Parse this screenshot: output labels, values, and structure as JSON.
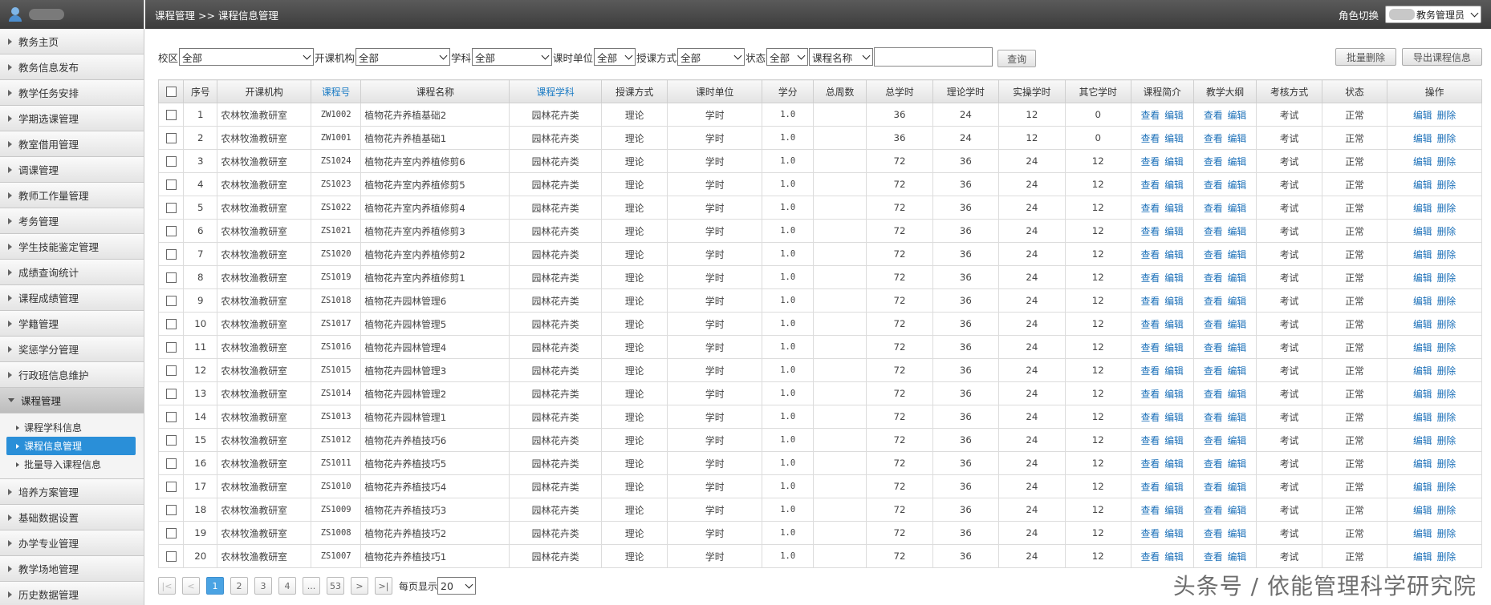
{
  "sidebar": {
    "items_top": [
      "教务主页",
      "教务信息发布",
      "教学任务安排",
      "学期选课管理",
      "教室借用管理",
      "调课管理",
      "教师工作量管理",
      "考务管理",
      "学生技能鉴定管理",
      "成绩查询统计",
      "课程成绩管理",
      "学籍管理",
      "奖惩学分管理",
      "行政班信息维护"
    ],
    "open_item": "课程管理",
    "sub_items": [
      "课程学科信息",
      "课程信息管理",
      "批量导入课程信息"
    ],
    "active_sub": 1,
    "items_bottom": [
      "培养方案管理",
      "基础数据设置",
      "办学专业管理",
      "教学场地管理",
      "历史数据管理"
    ]
  },
  "header": {
    "breadcrumb": "课程管理 >> 课程信息管理",
    "role_label": "角色切换",
    "role_value": "教务管理员"
  },
  "filters": {
    "campus_label": "校区",
    "campus_value": "全部",
    "org_label": "开课机构",
    "org_value": "全部",
    "subject_label": "学科",
    "subject_value": "全部",
    "unit_label": "课时单位",
    "unit_value": "全部",
    "mode_label": "授课方式",
    "mode_value": "全部",
    "status_label": "状态",
    "status_value": "全部",
    "field_select": "课程名称",
    "search_value": "",
    "query_button": "查询",
    "batch_delete_button": "批量删除",
    "export_button": "导出课程信息"
  },
  "table": {
    "headers": [
      "序号",
      "开课机构",
      "课程号",
      "课程名称",
      "课程学科",
      "授课方式",
      "课时单位",
      "学分",
      "总周数",
      "总学时",
      "理论学时",
      "实操学时",
      "其它学时",
      "课程简介",
      "教学大纲",
      "考核方式",
      "状态",
      "操作"
    ],
    "sortable": [
      2,
      4
    ],
    "link_view": "查看",
    "link_edit": "编辑",
    "link_delete": "删除",
    "rows": [
      [
        "1",
        "农林牧渔教研室",
        "ZW1002",
        "植物花卉养植基础2",
        "园林花卉类",
        "理论",
        "学时",
        "1.0",
        "",
        "36",
        "24",
        "12",
        "0",
        "考试",
        "正常"
      ],
      [
        "2",
        "农林牧渔教研室",
        "ZW1001",
        "植物花卉养植基础1",
        "园林花卉类",
        "理论",
        "学时",
        "1.0",
        "",
        "36",
        "24",
        "12",
        "0",
        "考试",
        "正常"
      ],
      [
        "3",
        "农林牧渔教研室",
        "ZS1024",
        "植物花卉室内养植修剪6",
        "园林花卉类",
        "理论",
        "学时",
        "1.0",
        "",
        "72",
        "36",
        "24",
        "12",
        "考试",
        "正常"
      ],
      [
        "4",
        "农林牧渔教研室",
        "ZS1023",
        "植物花卉室内养植修剪5",
        "园林花卉类",
        "理论",
        "学时",
        "1.0",
        "",
        "72",
        "36",
        "24",
        "12",
        "考试",
        "正常"
      ],
      [
        "5",
        "农林牧渔教研室",
        "ZS1022",
        "植物花卉室内养植修剪4",
        "园林花卉类",
        "理论",
        "学时",
        "1.0",
        "",
        "72",
        "36",
        "24",
        "12",
        "考试",
        "正常"
      ],
      [
        "6",
        "农林牧渔教研室",
        "ZS1021",
        "植物花卉室内养植修剪3",
        "园林花卉类",
        "理论",
        "学时",
        "1.0",
        "",
        "72",
        "36",
        "24",
        "12",
        "考试",
        "正常"
      ],
      [
        "7",
        "农林牧渔教研室",
        "ZS1020",
        "植物花卉室内养植修剪2",
        "园林花卉类",
        "理论",
        "学时",
        "1.0",
        "",
        "72",
        "36",
        "24",
        "12",
        "考试",
        "正常"
      ],
      [
        "8",
        "农林牧渔教研室",
        "ZS1019",
        "植物花卉室内养植修剪1",
        "园林花卉类",
        "理论",
        "学时",
        "1.0",
        "",
        "72",
        "36",
        "24",
        "12",
        "考试",
        "正常"
      ],
      [
        "9",
        "农林牧渔教研室",
        "ZS1018",
        "植物花卉园林管理6",
        "园林花卉类",
        "理论",
        "学时",
        "1.0",
        "",
        "72",
        "36",
        "24",
        "12",
        "考试",
        "正常"
      ],
      [
        "10",
        "农林牧渔教研室",
        "ZS1017",
        "植物花卉园林管理5",
        "园林花卉类",
        "理论",
        "学时",
        "1.0",
        "",
        "72",
        "36",
        "24",
        "12",
        "考试",
        "正常"
      ],
      [
        "11",
        "农林牧渔教研室",
        "ZS1016",
        "植物花卉园林管理4",
        "园林花卉类",
        "理论",
        "学时",
        "1.0",
        "",
        "72",
        "36",
        "24",
        "12",
        "考试",
        "正常"
      ],
      [
        "12",
        "农林牧渔教研室",
        "ZS1015",
        "植物花卉园林管理3",
        "园林花卉类",
        "理论",
        "学时",
        "1.0",
        "",
        "72",
        "36",
        "24",
        "12",
        "考试",
        "正常"
      ],
      [
        "13",
        "农林牧渔教研室",
        "ZS1014",
        "植物花卉园林管理2",
        "园林花卉类",
        "理论",
        "学时",
        "1.0",
        "",
        "72",
        "36",
        "24",
        "12",
        "考试",
        "正常"
      ],
      [
        "14",
        "农林牧渔教研室",
        "ZS1013",
        "植物花卉园林管理1",
        "园林花卉类",
        "理论",
        "学时",
        "1.0",
        "",
        "72",
        "36",
        "24",
        "12",
        "考试",
        "正常"
      ],
      [
        "15",
        "农林牧渔教研室",
        "ZS1012",
        "植物花卉养植技巧6",
        "园林花卉类",
        "理论",
        "学时",
        "1.0",
        "",
        "72",
        "36",
        "24",
        "12",
        "考试",
        "正常"
      ],
      [
        "16",
        "农林牧渔教研室",
        "ZS1011",
        "植物花卉养植技巧5",
        "园林花卉类",
        "理论",
        "学时",
        "1.0",
        "",
        "72",
        "36",
        "24",
        "12",
        "考试",
        "正常"
      ],
      [
        "17",
        "农林牧渔教研室",
        "ZS1010",
        "植物花卉养植技巧4",
        "园林花卉类",
        "理论",
        "学时",
        "1.0",
        "",
        "72",
        "36",
        "24",
        "12",
        "考试",
        "正常"
      ],
      [
        "18",
        "农林牧渔教研室",
        "ZS1009",
        "植物花卉养植技巧3",
        "园林花卉类",
        "理论",
        "学时",
        "1.0",
        "",
        "72",
        "36",
        "24",
        "12",
        "考试",
        "正常"
      ],
      [
        "19",
        "农林牧渔教研室",
        "ZS1008",
        "植物花卉养植技巧2",
        "园林花卉类",
        "理论",
        "学时",
        "1.0",
        "",
        "72",
        "36",
        "24",
        "12",
        "考试",
        "正常"
      ],
      [
        "20",
        "农林牧渔教研室",
        "ZS1007",
        "植物花卉养植技巧1",
        "园林花卉类",
        "理论",
        "学时",
        "1.0",
        "",
        "72",
        "36",
        "24",
        "12",
        "考试",
        "正常"
      ]
    ]
  },
  "pager": {
    "first": "|<",
    "prev": "<",
    "pages": [
      "1",
      "2",
      "3",
      "4",
      "...",
      "53"
    ],
    "current": "1",
    "next": ">",
    "last": ">|",
    "per_page_label": "每页显示",
    "per_page_value": "20"
  },
  "watermark": "头条号 / 依能管理科学研究院"
}
